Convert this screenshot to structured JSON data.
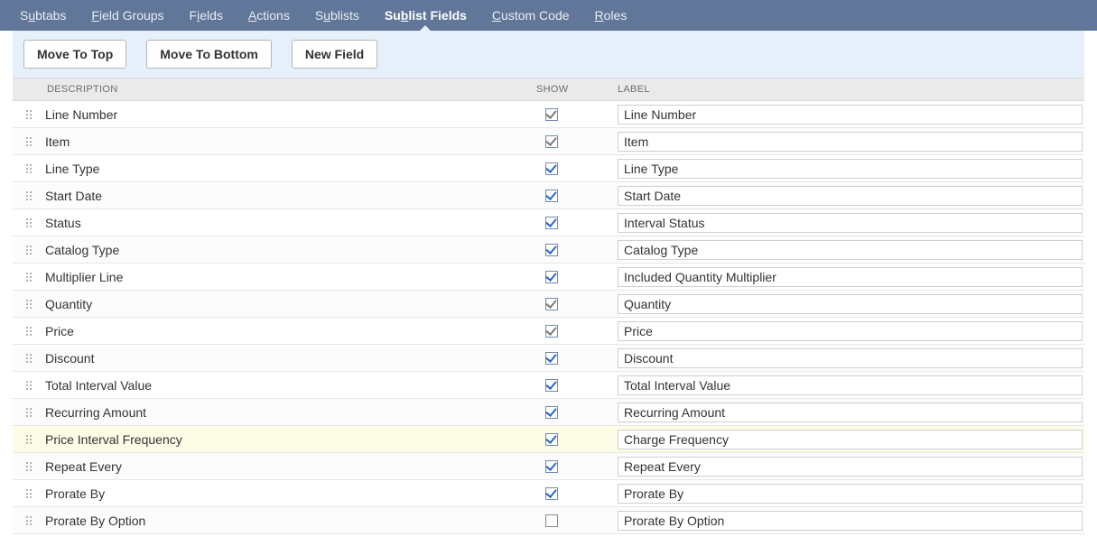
{
  "tabs": [
    {
      "label_pre": "S",
      "label_ul": "u",
      "label_post": "btabs",
      "active": false
    },
    {
      "label_pre": "",
      "label_ul": "F",
      "label_post": "ield Groups",
      "active": false
    },
    {
      "label_pre": "F",
      "label_ul": "i",
      "label_post": "elds",
      "active": false
    },
    {
      "label_pre": "",
      "label_ul": "A",
      "label_post": "ctions",
      "active": false
    },
    {
      "label_pre": "S",
      "label_ul": "u",
      "label_post": "blists",
      "active": false
    },
    {
      "label_pre": "Su",
      "label_ul": "b",
      "label_post": "list Fields",
      "active": true
    },
    {
      "label_pre": "",
      "label_ul": "C",
      "label_post": "ustom Code",
      "active": false
    },
    {
      "label_pre": "",
      "label_ul": "R",
      "label_post": "oles",
      "active": false
    }
  ],
  "toolbar": {
    "move_top": "Move To Top",
    "move_bottom": "Move To Bottom",
    "new_field": "New Field"
  },
  "columns": {
    "description": "DESCRIPTION",
    "show": "SHOW",
    "label": "LABEL"
  },
  "rows": [
    {
      "description": "Line Number",
      "show": true,
      "grey": true,
      "label": "Line Number",
      "highlight": false
    },
    {
      "description": "Item",
      "show": true,
      "grey": true,
      "label": "Item",
      "highlight": false
    },
    {
      "description": "Line Type",
      "show": true,
      "grey": false,
      "label": "Line Type",
      "highlight": false
    },
    {
      "description": "Start Date",
      "show": true,
      "grey": false,
      "label": "Start Date",
      "highlight": false
    },
    {
      "description": "Status",
      "show": true,
      "grey": false,
      "label": "Interval Status",
      "highlight": false
    },
    {
      "description": "Catalog Type",
      "show": true,
      "grey": false,
      "label": "Catalog Type",
      "highlight": false
    },
    {
      "description": "Multiplier Line",
      "show": true,
      "grey": false,
      "label": "Included Quantity Multiplier",
      "highlight": false
    },
    {
      "description": "Quantity",
      "show": true,
      "grey": true,
      "label": "Quantity",
      "highlight": false
    },
    {
      "description": "Price",
      "show": true,
      "grey": true,
      "label": "Price",
      "highlight": false
    },
    {
      "description": "Discount",
      "show": true,
      "grey": false,
      "label": "Discount",
      "highlight": false
    },
    {
      "description": "Total Interval Value",
      "show": true,
      "grey": false,
      "label": "Total Interval Value",
      "highlight": false
    },
    {
      "description": "Recurring Amount",
      "show": true,
      "grey": false,
      "label": "Recurring Amount",
      "highlight": false
    },
    {
      "description": "Price Interval Frequency",
      "show": true,
      "grey": false,
      "label": "Charge Frequency",
      "highlight": true
    },
    {
      "description": "Repeat Every",
      "show": true,
      "grey": false,
      "label": "Repeat Every",
      "highlight": false
    },
    {
      "description": "Prorate By",
      "show": true,
      "grey": false,
      "label": "Prorate By",
      "highlight": false
    },
    {
      "description": "Prorate By Option",
      "show": false,
      "grey": false,
      "label": "Prorate By Option",
      "highlight": false
    }
  ]
}
